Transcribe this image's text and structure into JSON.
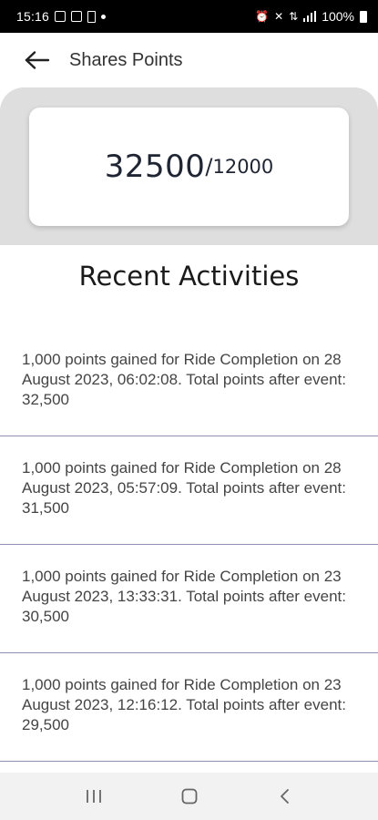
{
  "status_bar": {
    "time": "15:16",
    "battery_percent": "100%",
    "icons": [
      "notification-e-icon",
      "gallery-icon",
      "phone-icon",
      "dot-icon",
      "alarm-icon",
      "mute-icon",
      "data-icon",
      "signal-icon",
      "battery-icon"
    ]
  },
  "app_bar": {
    "back_icon": "arrow-left-icon",
    "title": "Shares Points"
  },
  "points": {
    "current": "32500",
    "separator": "/",
    "target": "12000"
  },
  "recent": {
    "title": "Recent Activities",
    "items": [
      {
        "text": "1,000 points gained for Ride Completion on 28 August 2023, 06:02:08. Total points after event: 32,500"
      },
      {
        "text": "1,000 points gained for Ride Completion on 28 August 2023, 05:57:09. Total points after event: 31,500"
      },
      {
        "text": "1,000 points gained for Ride Completion on 23 August 2023, 13:33:31. Total points after event: 30,500"
      },
      {
        "text": "1,000 points gained for Ride Completion on 23 August 2023, 12:16:12. Total points after event: 29,500"
      }
    ]
  },
  "nav_bar": {
    "icons": [
      "recents-icon",
      "home-icon",
      "back-nav-icon"
    ]
  },
  "colors": {
    "header_background": "#dedede",
    "divider": "#8f8faf",
    "points_text": "#1f2532"
  }
}
